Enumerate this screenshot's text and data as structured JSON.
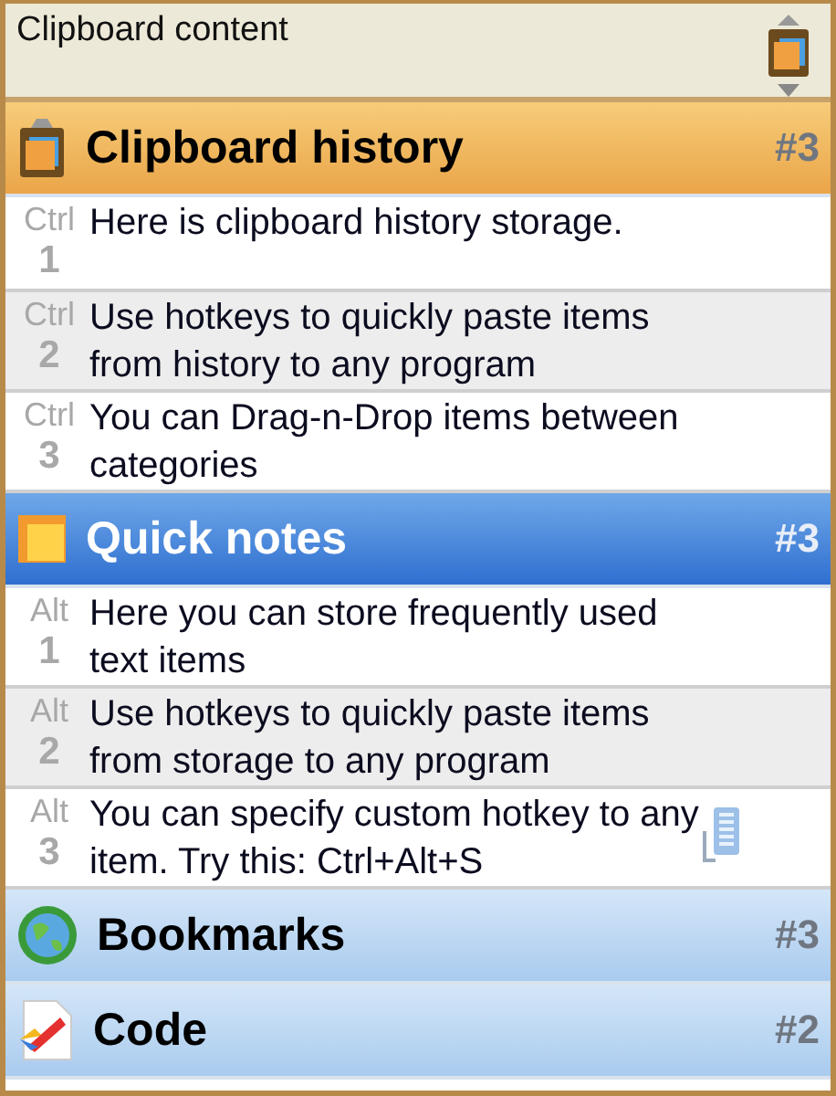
{
  "panel": {
    "title": "Clipboard content"
  },
  "categories": [
    {
      "kind": "history",
      "title": "Clipboard history",
      "count": "#3",
      "selected": false,
      "items": [
        {
          "modifier": "Ctrl",
          "number": "1",
          "text": "Here is clipboard history storage.",
          "custom_hotkey": false
        },
        {
          "modifier": "Ctrl",
          "number": "2",
          "text": "Use hotkeys to quickly paste items from history to any program",
          "custom_hotkey": false
        },
        {
          "modifier": "Ctrl",
          "number": "3",
          "text": "You can Drag-n-Drop items between categories",
          "custom_hotkey": false
        }
      ]
    },
    {
      "kind": "notes",
      "title": "Quick notes",
      "count": "#3",
      "selected": true,
      "items": [
        {
          "modifier": "Alt",
          "number": "1",
          "text": "Here you can store frequently used text items",
          "custom_hotkey": false
        },
        {
          "modifier": "Alt",
          "number": "2",
          "text": "Use hotkeys to quickly paste items from storage to any program",
          "custom_hotkey": false
        },
        {
          "modifier": "Alt",
          "number": "3",
          "text": "You can specify custom hotkey to any item. Try this: Ctrl+Alt+S",
          "custom_hotkey": true
        }
      ]
    },
    {
      "kind": "bookmarks",
      "title": "Bookmarks",
      "count": "#3",
      "selected": false
    },
    {
      "kind": "code",
      "title": "Code",
      "count": "#2",
      "selected": false
    }
  ]
}
